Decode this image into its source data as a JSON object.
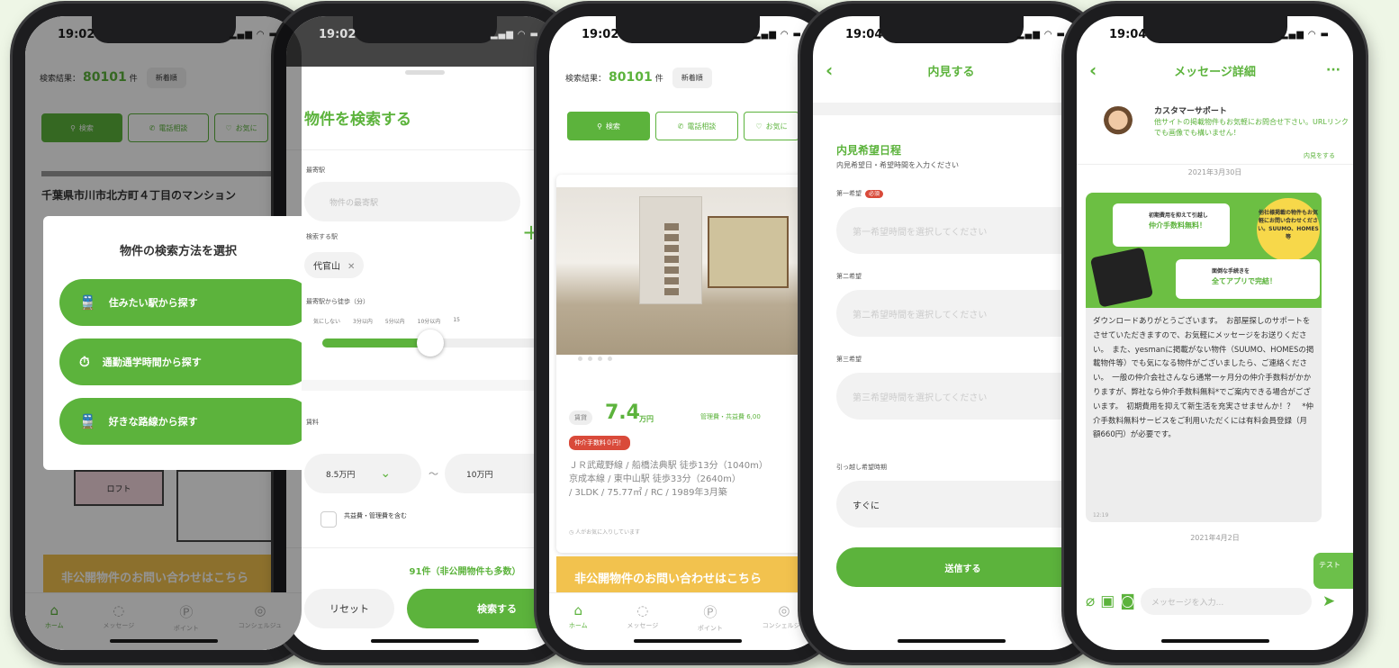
{
  "phone1": {
    "time": "19:02",
    "result_label": "検索結果：",
    "result_count": "80101",
    "result_unit": "件",
    "sort_label": "新着順",
    "chip_search": "検索",
    "chip_phone": "電話相談",
    "chip_fav": "お気に",
    "listing_title": "千葉県市川市北方町４丁目のマンション",
    "modal_title": "物件の検索方法を選択",
    "options": [
      "住みたい駅から探す",
      "通勤通学時間から探す",
      "好きな路線から探す"
    ],
    "floor_label": "ロフト",
    "banner": "非公開物件のお問い合わせはこちら",
    "tabs": [
      "ホーム",
      "メッセージ",
      "ポイント",
      "コンシェルジュ"
    ]
  },
  "phone2": {
    "time": "19:02",
    "title": "物件を検索する",
    "station_label": "最寄駅",
    "station_placeholder": "物件の最寄駅",
    "search_station_label": "検索する駅",
    "selected_station": "代官山",
    "walk_label": "最寄駅から徒歩（分）",
    "walk_ticks": [
      "気にしない",
      "3分以内",
      "5分以内",
      "10分以内",
      "15"
    ],
    "walk_value": "5分以内",
    "rent_label": "賃料",
    "rent_min": "8.5万円",
    "rent_sep": "〜",
    "rent_max": "10万円",
    "include_fee": "共益費・管理費を含む",
    "result_text": "91件（非公開物件も多数）",
    "reset": "リセット",
    "search": "検索する"
  },
  "phone3": {
    "time": "19:02",
    "result_label": "検索結果：",
    "result_count": "80101",
    "result_unit": "件",
    "sort_label": "新着順",
    "chip_search": "検索",
    "chip_phone": "電話相談",
    "chip_fav": "お気に",
    "rent_tag": "賃貸",
    "price": "7.4",
    "price_unit": "万円",
    "mgmt_fee": "管理費・共益費 6,00",
    "badge": "仲介手数料０円！",
    "info": [
      "ＪＲ武蔵野線 / 船橋法典駅 徒歩13分（1040m）",
      "京成本線 / 東中山駅 徒歩33分（2640m）",
      "/ 3LDK / 75.77㎡ / RC / 1989年3月築"
    ],
    "viewers": "人がお気に入りしています",
    "banner": "非公開物件のお問い合わせはこちら",
    "tabs": [
      "ホーム",
      "メッセージ",
      "ポイント",
      "コンシェルジュ"
    ]
  },
  "phone4": {
    "time": "19:04",
    "title": "内見する",
    "section_title": "内見希望日程",
    "section_sub": "内見希望日・希望時間を入力ください",
    "pref1_label": "第一希望",
    "required": "必須",
    "pref1_placeholder": "第一希望時間を選択してください",
    "pref2_label": "第二希望",
    "pref2_placeholder": "第二希望時間を選択してください",
    "pref3_label": "第三希望",
    "pref3_placeholder": "第三希望時間を選択してください",
    "move_label": "引っ越し希望時期",
    "move_value": "すぐに",
    "submit": "送信する"
  },
  "phone5": {
    "time": "19:04",
    "title": "メッセージ詳細",
    "more": "···",
    "sender": "カスタマーサポート",
    "intro": "他サイトの掲載物件もお気軽にお問合せ下さい。URLリンクでも画像でも構いません！",
    "intro_link": "内見をする",
    "date1": "2021年3月30日",
    "ad_line1": "初期費用を抑えて引越し",
    "ad_line2": "仲介手数料無料！",
    "ad_circle": "他社様掲載の物件もお気軽にお問い合わせください。SUUMO、HOMES等",
    "ad_line3": "面倒な手続きを",
    "ad_line4": "全てアプリで完結！",
    "body": "ダウンロードありがとうございます。　お部屋探しのサポートをさせていただきますので、お気軽にメッセージをお送りください。　また、yesmanに掲載がない物件（SUUMO、HOMESの掲載物件等）でも気になる物件がございましたら、ご連絡ください。　一般の仲介会社さんなら通常一ヶ月分の仲介手数料がかかりますが、弊社なら仲介手数料無料*でご案内できる場合がございます。　初期費用を抑えて新生活を充実させませんか！？　*仲介手数料無料サービスをご利用いただくには有料会員登録（月額660円）が必要です。",
    "time_sent": "12:19",
    "date2": "2021年4月2日",
    "my_msg": "テスト",
    "input_placeholder": "メッセージを入力..."
  },
  "accent": "#5cb33c",
  "banner_color": "#f2c24e",
  "badge_color": "#d94a3a"
}
